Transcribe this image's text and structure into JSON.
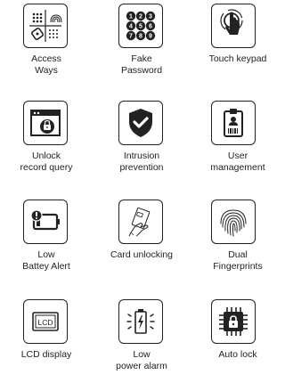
{
  "features": [
    {
      "label": "Access\nWays",
      "icon": "access-ways-icon"
    },
    {
      "label": "Fake\nPassword",
      "icon": "keypad-digits-icon"
    },
    {
      "label": "Touch keypad",
      "icon": "touch-finger-icon"
    },
    {
      "label": "Unlock\nrecord query",
      "icon": "record-lock-icon"
    },
    {
      "label": "Intrusion\nprevention",
      "icon": "shield-check-icon"
    },
    {
      "label": "User\nmanagement",
      "icon": "id-badge-icon"
    },
    {
      "label": "Low\nBattey Alert",
      "icon": "low-battery-icon"
    },
    {
      "label": "Card unlocking",
      "icon": "card-hand-icon"
    },
    {
      "label": "Dual\nFingerprints",
      "icon": "fingerprint-icon"
    },
    {
      "label": "LCD display",
      "icon": "lcd-icon"
    },
    {
      "label": "Low\npower alarm",
      "icon": "battery-alarm-icon"
    },
    {
      "label": "Auto lock",
      "icon": "chip-lock-icon"
    }
  ],
  "keypad_digits": [
    "1",
    "2",
    "3",
    "4",
    "5",
    "6",
    "7",
    "8",
    "9"
  ],
  "lcd_text": "LCD"
}
